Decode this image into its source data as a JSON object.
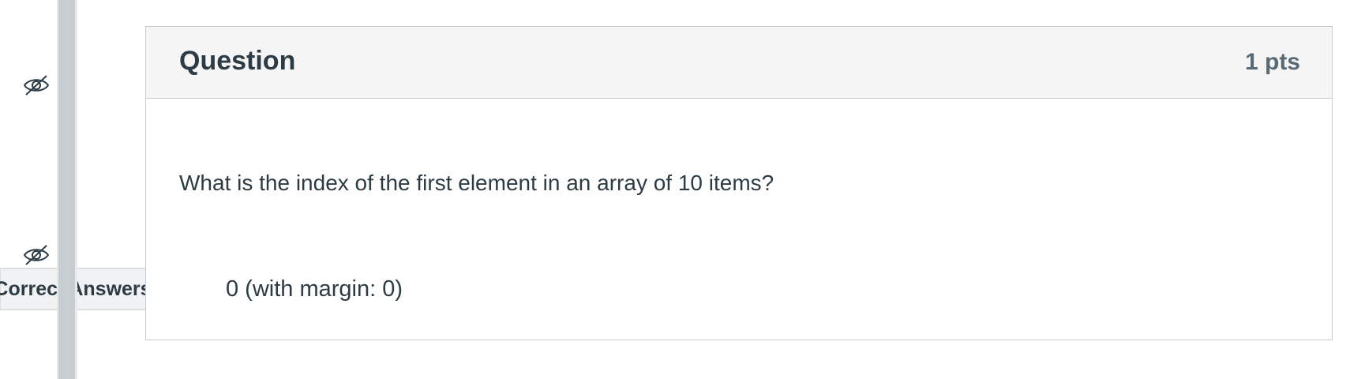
{
  "question": {
    "title": "Question",
    "points": "1 pts",
    "text": "What is the index of the first element in an array of 10 items?"
  },
  "answers": {
    "label": "Correct Answers",
    "value": "0 (with margin: 0)"
  },
  "icons": {
    "visibility_top": "eye-slash-icon",
    "visibility_bottom": "eye-slash-icon"
  },
  "colors": {
    "text": "#2d3b45",
    "header_background": "#f5f5f5",
    "border": "#c7cdd1",
    "divider": "#c7cdd1"
  }
}
